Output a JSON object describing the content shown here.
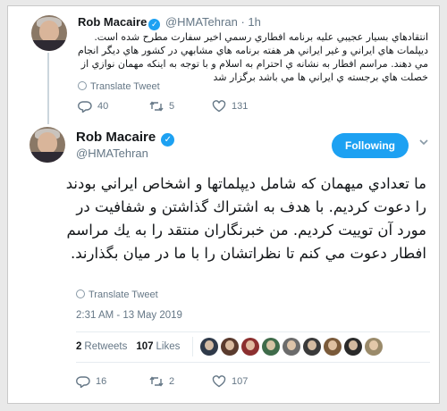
{
  "tweet1": {
    "author_name": "Rob Macaire",
    "handle": "@HMATehran",
    "separator": "·",
    "time_ago": "1h",
    "text": "انتقادهاي بسيار عجيبي عليه برنامه افطاري رسمي اخير سفارت مطرح شده است. ديپلمات هاي ايراني و غير ايراني هر هفته برنامه هاي مشابهي در كشور هاي ديگر انجام مي دهند. مراسم افطار به نشانه ي احترام به اسلام و با توجه به اينكه مهمان نوازي از خصلت هاي برجسته ي ايراني ها مي باشد برگزار شد",
    "translate_label": "Translate Tweet",
    "replies": "40",
    "retweets": "5",
    "likes": "131"
  },
  "tweet2": {
    "author_name": "Rob Macaire",
    "handle": "@HMATehran",
    "follow_label": "Following",
    "text": "ما تعدادي ميهمان كه شامل ديپلماتها و اشخاص ايراني بودند را دعوت كرديم. با هدف به اشتراك گذاشتن و شفافيت در مورد آن توييت كرديم. من خبرنگاران منتقد را به يك مراسم افطار دعوت مي كنم تا نظراتشان را با ما در ميان بگذارند.",
    "translate_label": "Translate Tweet",
    "timestamp": "2:31 AM - 13 May 2019",
    "retweets_count": "2",
    "retweets_label": "Retweets",
    "likes_count": "107",
    "likes_label": "Likes",
    "replies": "16",
    "retweets": "2",
    "likes": "107"
  },
  "liker_avatars": [
    "#2f3a4a",
    "#5a3b2e",
    "#8c2f2f",
    "#3f6b4a",
    "#6b6b6b",
    "#3a3a3a",
    "#7a5a3a",
    "#2a2a2a",
    "#9a8a6a"
  ],
  "icons": {
    "reply": "reply-icon",
    "retweet": "retweet-icon",
    "like": "heart-icon",
    "verified": "verified-badge-icon",
    "translate": "globe-icon",
    "caret": "chevron-down-icon"
  },
  "colors": {
    "accent": "#1da1f2",
    "muted": "#657786",
    "text": "#14171a"
  }
}
